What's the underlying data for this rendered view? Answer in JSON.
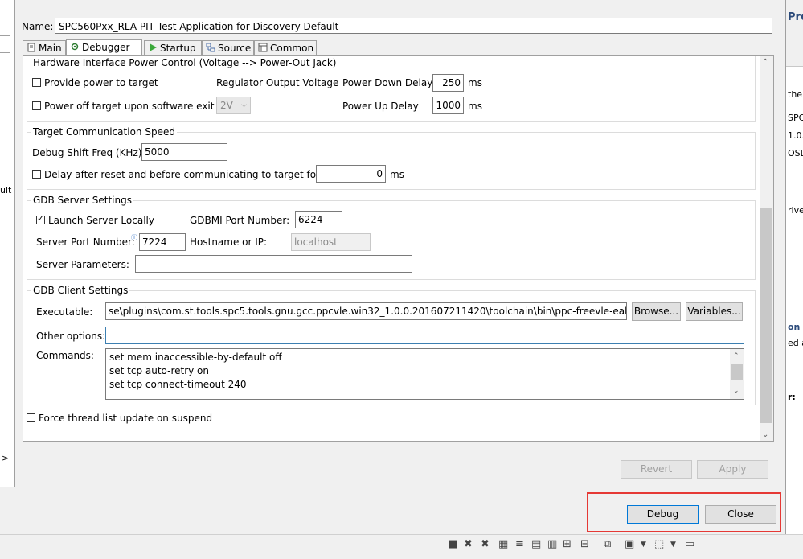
{
  "dialog": {
    "name_label": "Name:",
    "name_value": "SPC560Pxx_RLA PIT Test Application for Discovery Default"
  },
  "tabs": [
    {
      "label": "Main",
      "icon": "document-icon"
    },
    {
      "label": "Debugger",
      "icon": "bug-gear-icon"
    },
    {
      "label": "Startup",
      "icon": "play-icon"
    },
    {
      "label": "Source",
      "icon": "source-icon"
    },
    {
      "label": "Common",
      "icon": "common-icon"
    }
  ],
  "hw_power": {
    "title": "Hardware Interface Power Control (Voltage --> Power-Out Jack)",
    "provide_power_label": "Provide power to target",
    "power_off_label": "Power off target upon software exit",
    "regulator_label": "Regulator Output Voltage",
    "regulator_value": "2V",
    "power_down_label": "Power Down Delay",
    "power_down_value": "250",
    "power_up_label": "Power Up Delay",
    "power_up_value": "1000",
    "ms": "ms"
  },
  "comm_speed": {
    "title": "Target Communication Speed",
    "shift_freq_label": "Debug Shift Freq (KHz)",
    "shift_freq_value": "5000",
    "delay_label": "Delay after reset and before communicating to target for",
    "delay_value": "0",
    "ms": "ms"
  },
  "gdb_server": {
    "title": "GDB Server Settings",
    "launch_label": "Launch Server Locally",
    "gdbmi_label": "GDBMI Port Number:",
    "gdbmi_value": "6224",
    "server_port_label": "Server Port Number:",
    "server_port_value": "7224",
    "hostname_label": "Hostname or IP:",
    "hostname_value": "localhost",
    "params_label": "Server Parameters:",
    "params_value": ""
  },
  "gdb_client": {
    "title": "GDB Client Settings",
    "exec_label": "Executable:",
    "exec_value": "se\\plugins\\com.st.tools.spc5.tools.gnu.gcc.ppcvle.win32_1.0.0.201607211420\\toolchain\\bin\\ppc-freevle-eabi-gdb",
    "browse_label": "Browse...",
    "variables_label": "Variables...",
    "other_label": "Other options:",
    "other_value": "",
    "commands_label": "Commands:",
    "commands": [
      "set mem inaccessible-by-default off",
      "set tcp auto-retry on",
      "set tcp connect-timeout 240"
    ]
  },
  "force_thread_label": "Force thread list update on suspend",
  "buttons": {
    "revert": "Revert",
    "apply": "Apply",
    "debug": "Debug",
    "close": "Close"
  },
  "left_panel": {
    "text": "ult",
    "arrow": ">"
  },
  "right_panel": {
    "lines": [
      "Pro",
      "the s",
      "SPC",
      "1.0.",
      "OSL",
      "river",
      "on",
      "ed a",
      "r:"
    ]
  },
  "colors": {
    "highlight_border": "#e53935",
    "focus_border": "#3c7fb1"
  }
}
